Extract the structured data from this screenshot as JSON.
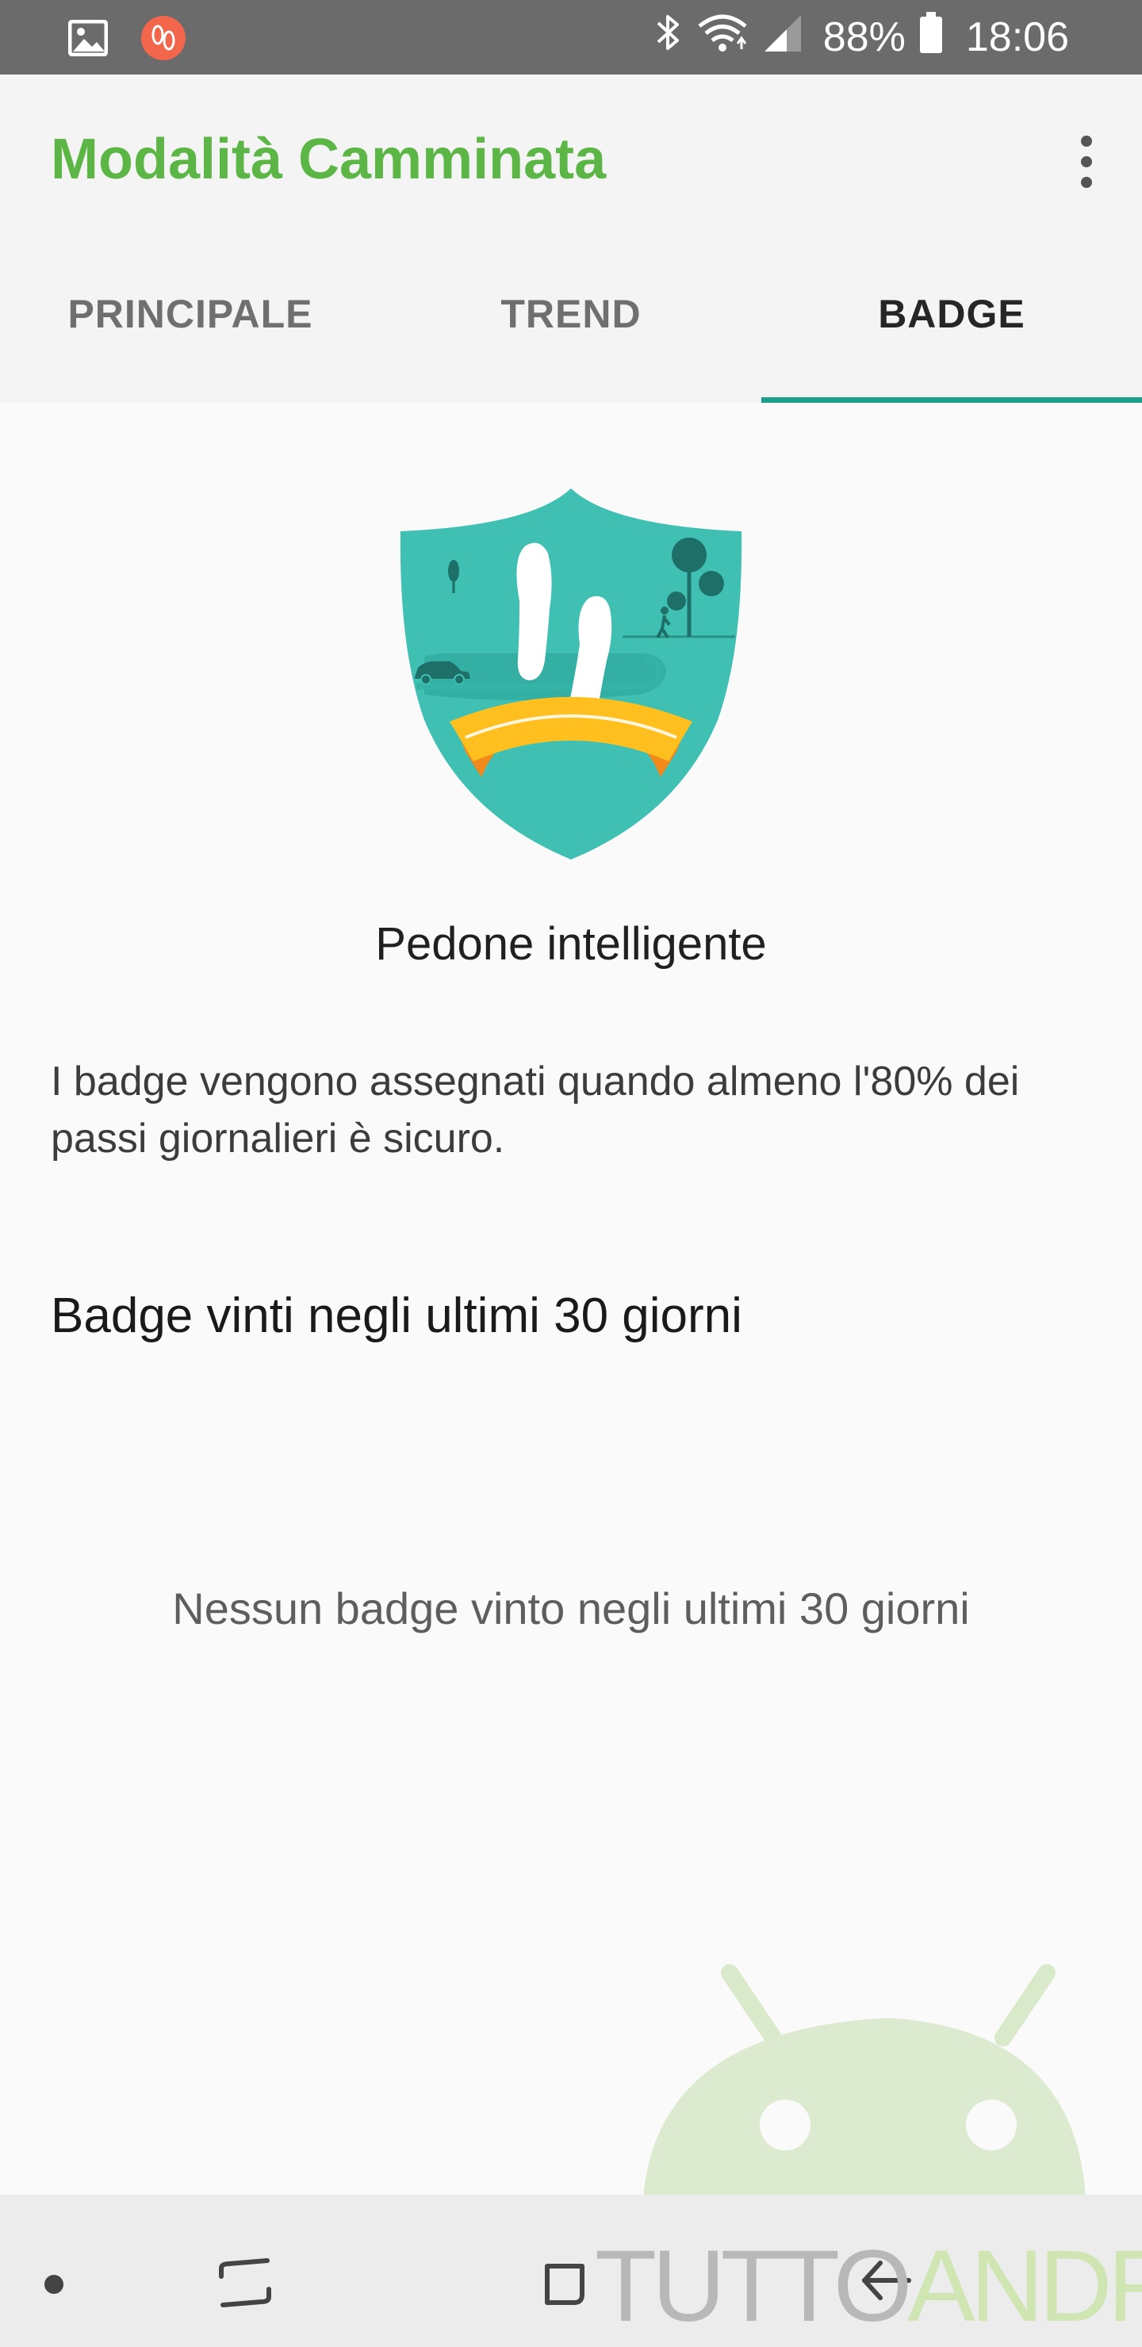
{
  "status_bar": {
    "battery_percent": "88%",
    "time": "18:06",
    "left_icons": [
      "gallery-icon",
      "walking-mode-icon"
    ],
    "right_icons": [
      "bluetooth-icon",
      "wifi-icon",
      "signal-icon",
      "battery-icon"
    ]
  },
  "app_bar": {
    "title": "Modalità Camminata",
    "title_color": "#5cb646",
    "menu_icon": "more-vert-icon"
  },
  "tabs": [
    {
      "label": "PRINCIPALE",
      "active": false
    },
    {
      "label": "TREND",
      "active": false
    },
    {
      "label": "BADGE",
      "active": true
    }
  ],
  "tab_indicator_color": "#1a9e8a",
  "badge": {
    "icon": "smart-pedestrian-shield-badge",
    "name": "Pedone intelligente"
  },
  "info_text": "I badge vengono assegnati quando almeno l'80% dei passi giornalieri è sicuro.",
  "section_heading": "Badge vinti negli ultimi 30 giorni",
  "empty_message": "Nessun badge vinto negli ultimi 30 giorni",
  "nav_bar": {
    "icons": [
      "nav-dot-icon",
      "recents-icon",
      "home-icon",
      "back-icon"
    ]
  },
  "watermark": {
    "text_part1": "TUTTO",
    "text_part2": "ANDROID"
  }
}
